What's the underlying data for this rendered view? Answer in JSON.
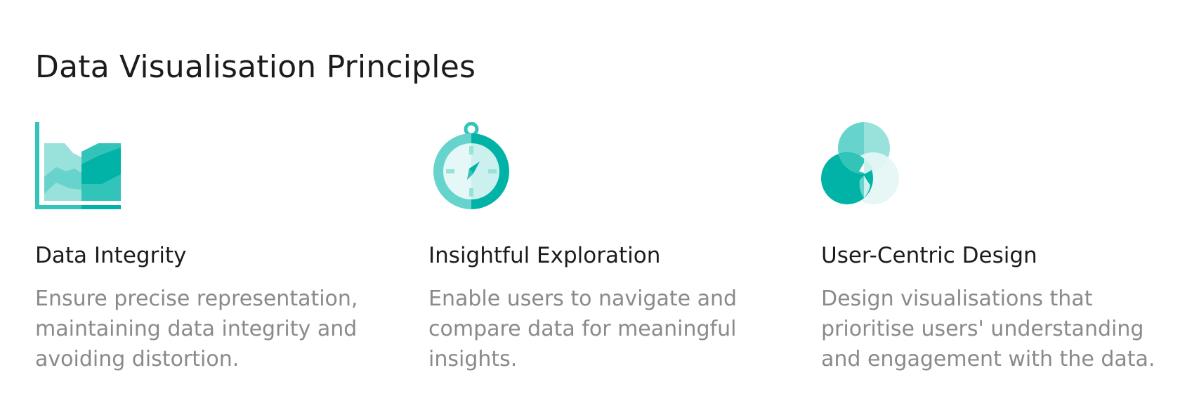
{
  "page": {
    "title": "Data Visualisation Principles"
  },
  "colors": {
    "teal_dark": "#00b3a6",
    "teal_mid": "#33c4b9",
    "teal_light": "#66d4cc",
    "teal_pale": "#99e1db",
    "teal_faint": "#ccf0ed",
    "teal_ghost": "#e5f7f6",
    "heading_text": "#1c1c1c",
    "body_text": "#8a8a8a"
  },
  "principles": [
    {
      "icon": "area-chart-icon",
      "heading": "Data Integrity",
      "text": "Ensure precise representation, maintaining data integrity and avoiding distortion."
    },
    {
      "icon": "compass-icon",
      "heading": "Insightful Exploration",
      "text": "Enable users to navigate and compare data for meaningful insights."
    },
    {
      "icon": "venn-circles-icon",
      "heading": "User-Centric Design",
      "text": "Design visualisations that prioritise users' understanding and engagement with the data."
    }
  ]
}
